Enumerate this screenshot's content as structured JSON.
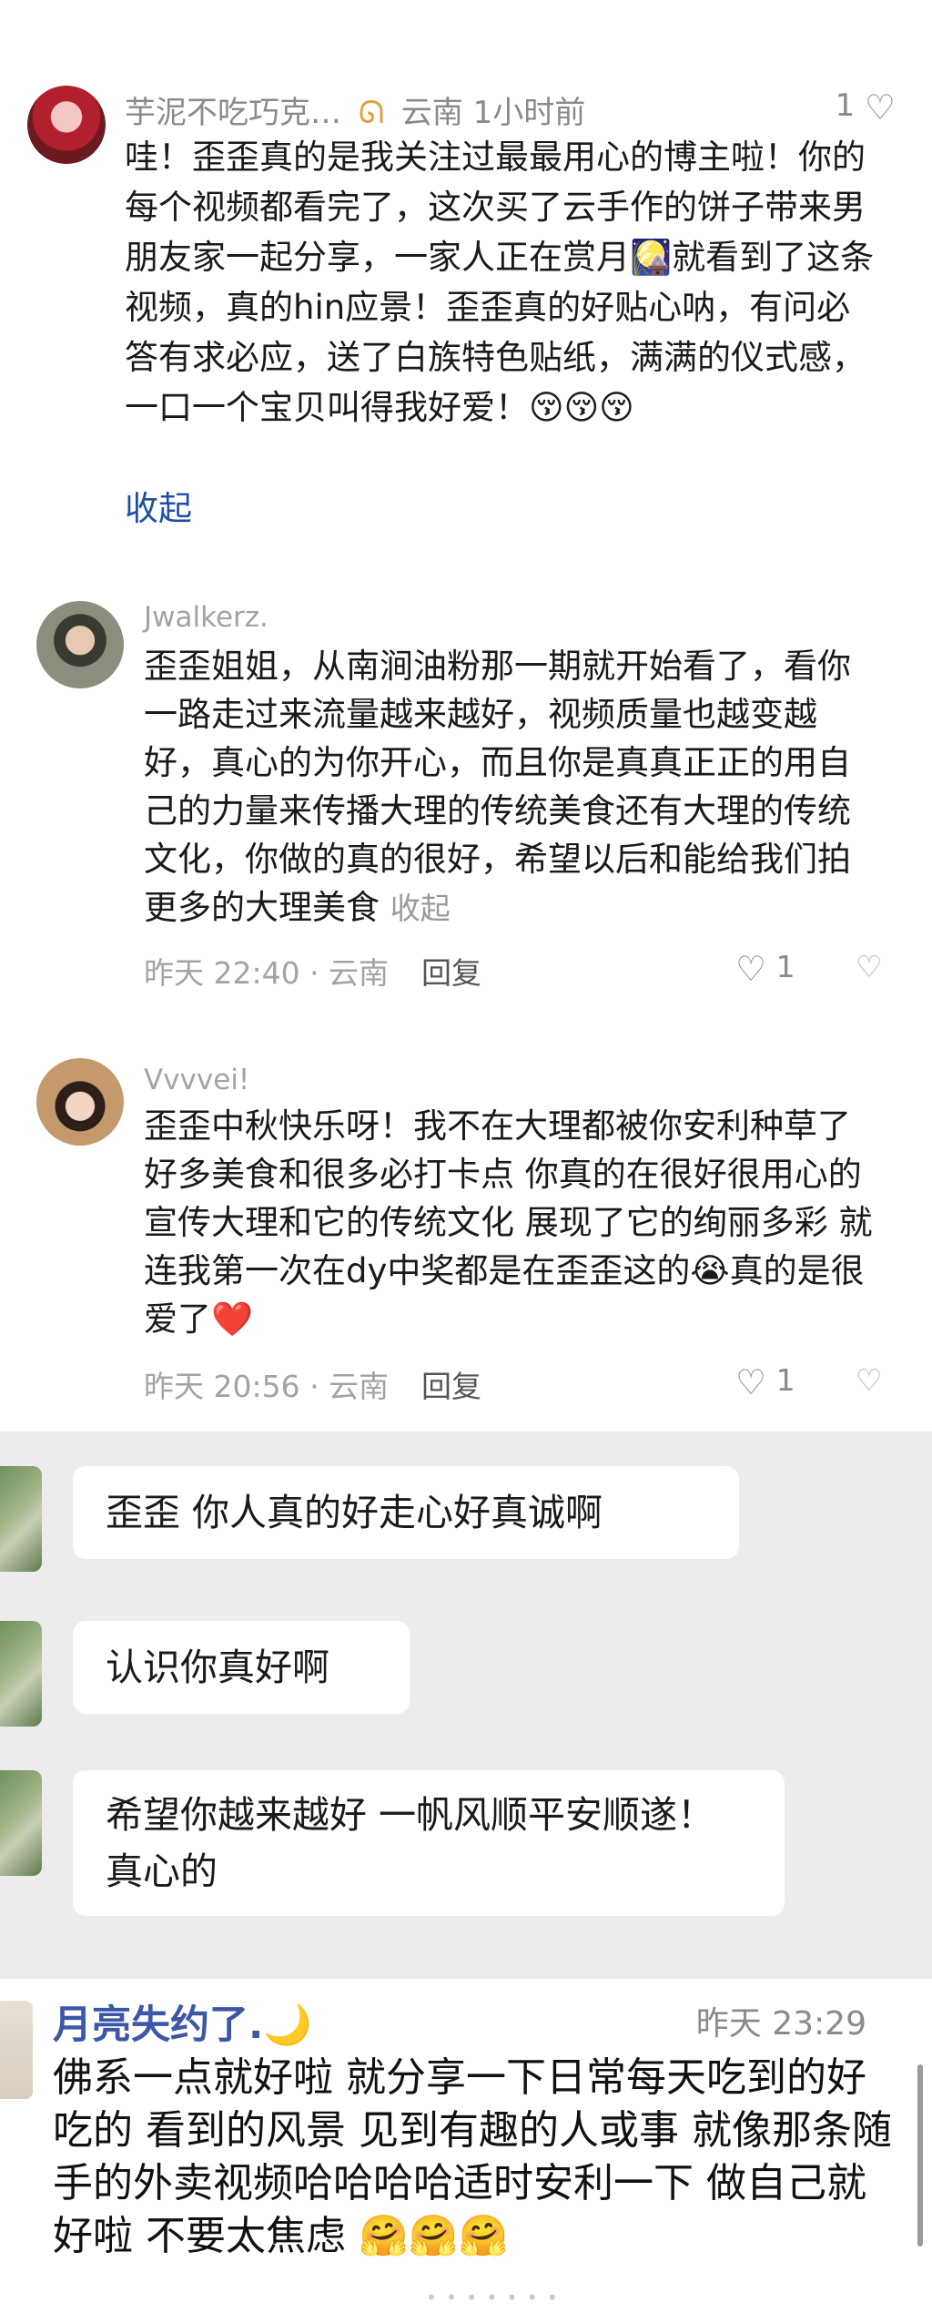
{
  "comment1": {
    "username": "芋泥不吃巧克…",
    "badge_icon": "ribbon-icon",
    "location_time": "云南 1小时前",
    "likes": "1",
    "text": "哇！歪歪真的是我关注过最最用心的博主啦！你的每个视频都看完了，这次买了云手作的饼子带来男朋友家一起分享，一家人正在赏月🎑就看到了这条视频，真的hin应景！歪歪真的好贴心呐，有问必答有求必应，送了白族特色贴纸，满满的仪式感，一口一个宝贝叫得我好爱！😚😚😚",
    "collapse_label": "收起"
  },
  "comment2": {
    "username": "Jwalkerz.",
    "text": "歪歪姐姐，从南涧油粉那一期就开始看了，看你一路走过来流量越来越好，视频质量也越变越好，真心的为你开心，而且你是真真正正的用自己的力量来传播大理的传统美食还有大理的传统文化，你做的真的很好，希望以后和能给我们拍更多的大理美食",
    "collapse_label": "收起",
    "time_location": "昨天 22:40 · 云南",
    "reply_label": "回复",
    "likes": "1"
  },
  "comment3": {
    "username": "Vvvvei!",
    "text": "歪歪中秋快乐呀！我不在大理都被你安利种草了好多美食和很多必打卡点 你真的在很好很用心的宣传大理和它的传统文化 展现了它的绚丽多彩 就连我第一次在dy中奖都是在歪歪这的😭真的是很爱了❤️",
    "time_location": "昨天 20:56 · 云南",
    "reply_label": "回复",
    "likes": "1"
  },
  "chat": {
    "messages": [
      "歪歪 你人真的好走心好真诚啊",
      "认识你真好啊",
      "希望你越来越好 一帆风顺平安顺遂！真心的"
    ]
  },
  "note": {
    "username": "月亮失约了.🌙",
    "time": "昨天 23:29",
    "text": "佛系一点就好啦 就分享一下日常每天吃到的好吃的 看到的风景 见到有趣的人或事 就像那条随手的外卖视频哈哈哈哈适时安利一下 做自己就好啦 不要太焦虑 🤗🤗🤗"
  }
}
